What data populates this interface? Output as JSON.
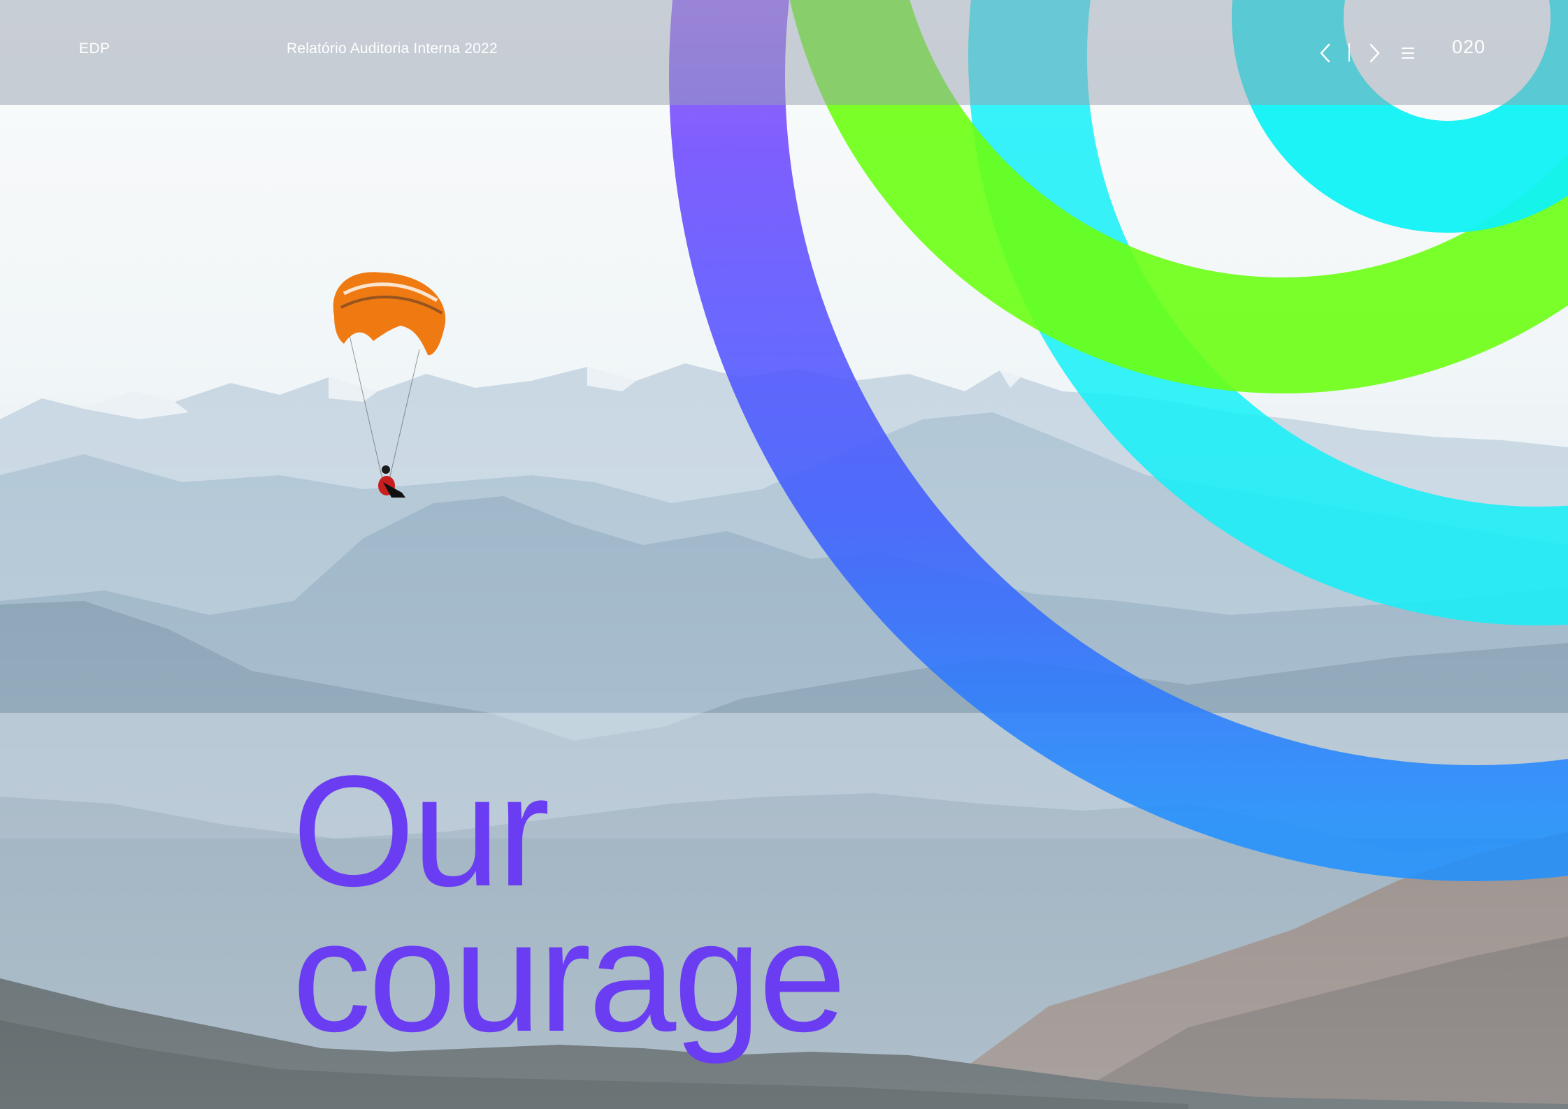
{
  "header": {
    "brand": "EDP",
    "document_title": "Relatório Auditoria Interna 2022",
    "page_number": "020",
    "icons": {
      "previous": "chevron-left-icon",
      "next": "chevron-right-icon",
      "menu": "hamburger-menu-icon"
    }
  },
  "hero": {
    "headline_line1": "Our",
    "headline_line2": "courage",
    "headline_color": "#6a3df2"
  },
  "colors": {
    "arc_violet": "#c76bff",
    "arc_blue": "#2f7dff",
    "arc_green": "#6cff12",
    "arc_cyan": "#12ecf7",
    "header_overlay": "#96a0af"
  }
}
